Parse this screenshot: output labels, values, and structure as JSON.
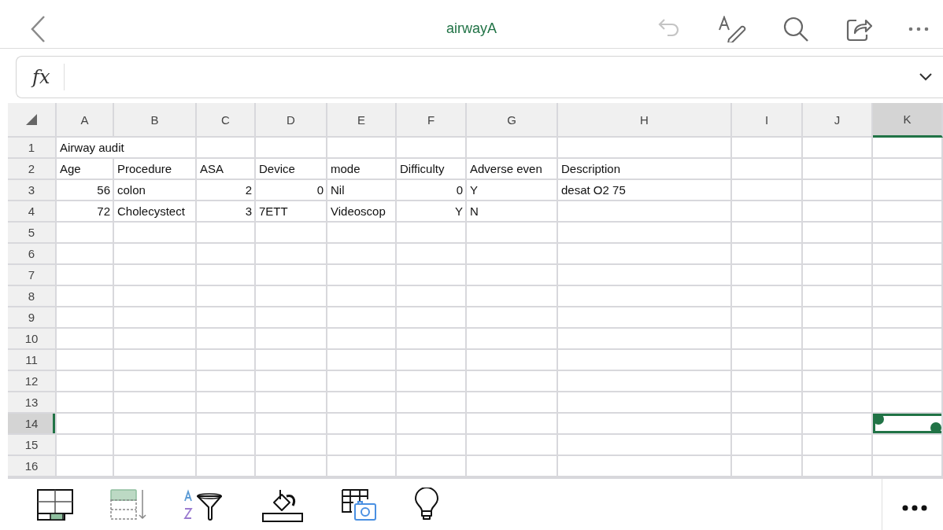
{
  "document": {
    "title": "airwayA"
  },
  "formula_bar": {
    "label": "fx"
  },
  "columns": [
    {
      "label": "A",
      "selected": false
    },
    {
      "label": "B",
      "selected": false
    },
    {
      "label": "C",
      "selected": false
    },
    {
      "label": "D",
      "selected": false
    },
    {
      "label": "E",
      "selected": false
    },
    {
      "label": "F",
      "selected": false
    },
    {
      "label": "G",
      "selected": false
    },
    {
      "label": "H",
      "selected": false
    },
    {
      "label": "I",
      "selected": false
    },
    {
      "label": "J",
      "selected": false
    },
    {
      "label": "K",
      "selected": true
    }
  ],
  "rows": [
    {
      "label": "1",
      "selected": false,
      "cells": [
        {
          "value": "Airway audit",
          "kind": "text"
        }
      ]
    },
    {
      "label": "2",
      "selected": false,
      "cells": [
        {
          "value": "Age",
          "kind": "text"
        },
        {
          "value": "Procedure",
          "kind": "text"
        },
        {
          "value": "ASA",
          "kind": "text"
        },
        {
          "value": "Device",
          "kind": "text"
        },
        {
          "value": "mode",
          "kind": "text"
        },
        {
          "value": "Difficulty",
          "kind": "text"
        },
        {
          "value": "Adverse even",
          "kind": "text"
        },
        {
          "value": "Description",
          "kind": "text"
        }
      ]
    },
    {
      "label": "3",
      "selected": false,
      "cells": [
        {
          "value": "56",
          "kind": "number"
        },
        {
          "value": "colon",
          "kind": "text"
        },
        {
          "value": "2",
          "kind": "number"
        },
        {
          "value": "0",
          "kind": "number"
        },
        {
          "value": "Nil",
          "kind": "text"
        },
        {
          "value": "0",
          "kind": "number"
        },
        {
          "value": "Y",
          "kind": "text"
        },
        {
          "value": "desat O2 75",
          "kind": "text"
        }
      ]
    },
    {
      "label": "4",
      "selected": false,
      "cells": [
        {
          "value": "72",
          "kind": "number"
        },
        {
          "value": "Cholecystect",
          "kind": "text"
        },
        {
          "value": "3",
          "kind": "number"
        },
        {
          "value": "7ETT",
          "kind": "text"
        },
        {
          "value": "Videoscop",
          "kind": "text"
        },
        {
          "value": "Y",
          "kind": "number"
        },
        {
          "value": "N",
          "kind": "text"
        }
      ]
    },
    {
      "label": "5",
      "selected": false,
      "cells": []
    },
    {
      "label": "6",
      "selected": false,
      "cells": []
    },
    {
      "label": "7",
      "selected": false,
      "cells": []
    },
    {
      "label": "8",
      "selected": false,
      "cells": []
    },
    {
      "label": "9",
      "selected": false,
      "cells": []
    },
    {
      "label": "10",
      "selected": false,
      "cells": []
    },
    {
      "label": "11",
      "selected": false,
      "cells": []
    },
    {
      "label": "12",
      "selected": false,
      "cells": []
    },
    {
      "label": "13",
      "selected": false,
      "cells": []
    },
    {
      "label": "14",
      "selected": true,
      "cells": []
    },
    {
      "label": "15",
      "selected": false,
      "cells": []
    },
    {
      "label": "16",
      "selected": false,
      "cells": []
    }
  ]
}
